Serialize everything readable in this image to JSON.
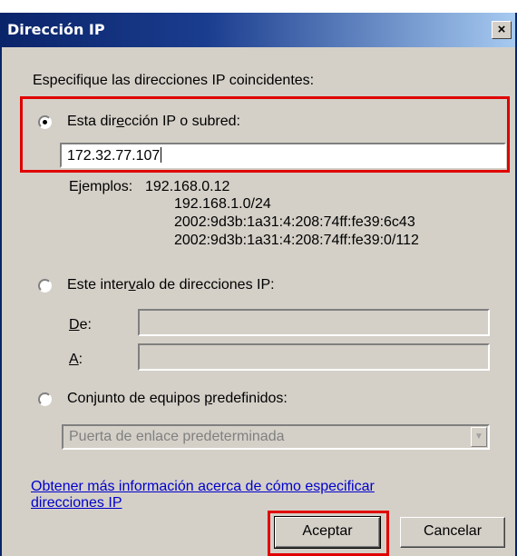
{
  "window": {
    "title": "Dirección IP",
    "close_glyph": "×"
  },
  "intro": "Especifique las direcciones IP coincidentes:",
  "option_subnet": {
    "label_a": "Esta dir",
    "label_u": "e",
    "label_b": "cción IP o subred:",
    "value": "172.32.77.107",
    "selected": true
  },
  "examples": {
    "label": "Ejemplos:",
    "lines": [
      "192.168.0.12",
      "192.168.1.0/24",
      "2002:9d3b:1a31:4:208:74ff:fe39:6c43",
      "2002:9d3b:1a31:4:208:74ff:fe39:0/112"
    ]
  },
  "option_range": {
    "label_a": "Este inter",
    "label_u": "v",
    "label_b": "alo de direcciones IP:",
    "selected": false,
    "from_u": "D",
    "from_b": "e:",
    "to_u": "A",
    "to_b": ":"
  },
  "option_predefined": {
    "label_a": "Conjunto de equipos ",
    "label_u": "p",
    "label_b": "redefinidos:",
    "selected": false,
    "dropdown_value": "Puerta de enlace predeterminada"
  },
  "help_link": {
    "line1": "Obtener más información acerca de cómo especificar",
    "line2": "direcciones IP"
  },
  "buttons": {
    "ok": "Aceptar",
    "cancel": "Cancelar"
  },
  "colors": {
    "highlight": "#e00000",
    "titlebar": "#0a246a",
    "link": "#0000cc"
  }
}
